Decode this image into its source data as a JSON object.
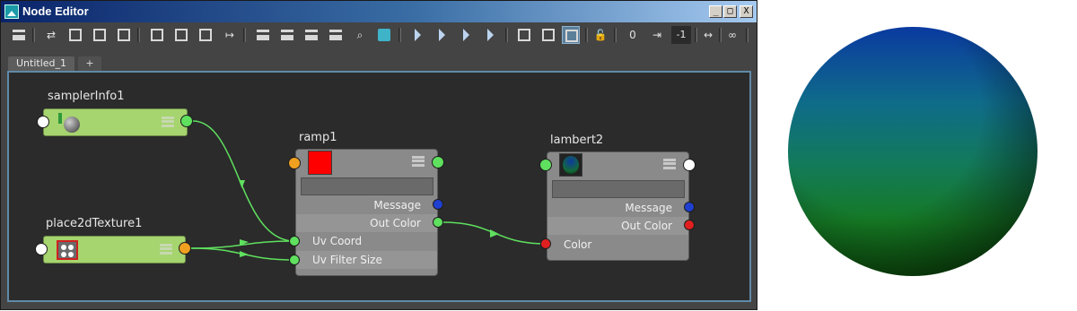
{
  "window": {
    "title": "Node Editor",
    "min_label": "_",
    "max_label": "□",
    "close_label": "X"
  },
  "toolbar": {
    "icons": [
      "add-node-icon",
      "swap-icon",
      "input-icon",
      "input-output-icon",
      "output-icon",
      "frame-all-icon",
      "frame-selected-icon",
      "layout-icon",
      "connect-icon",
      "simple-view-icon",
      "connected-view-icon",
      "full-view-icon",
      "custom-view-icon",
      "search-icon",
      "bookmark-icon",
      "graph-up-icon",
      "graph-down-icon",
      "remove-icon",
      "add-icon",
      "rearrange-icon",
      "clear-icon",
      "graph-materials-icon",
      "lock-icon",
      "dots-icon",
      "expand-icon",
      "minus-one-icon",
      "arrows-icon",
      "chain-icon"
    ],
    "minus_one_label": "-1",
    "dots_label": "0",
    "arrows_label": "↔",
    "chain_label": "∞"
  },
  "tabs": {
    "active": "Untitled_1",
    "add": "+"
  },
  "nodes": {
    "samplerInfo": {
      "title": "samplerInfo1"
    },
    "place2d": {
      "title": "place2dTexture1"
    },
    "ramp": {
      "title": "ramp1",
      "rows": [
        "Message",
        "Out Color",
        "Uv Coord",
        "Uv Filter Size"
      ]
    },
    "lambert": {
      "title": "lambert2",
      "rows": [
        "Message",
        "Out Color",
        "Color"
      ]
    }
  },
  "colors": {
    "port_white": "#ffffff",
    "port_green": "#5fe05f",
    "port_orange": "#f0a020",
    "port_blue": "#1f3fd0",
    "port_red": "#e02020",
    "wire": "#5fe05f",
    "ramp_swatch": "#ff0000",
    "accent_selected": "#5c7f9a"
  }
}
